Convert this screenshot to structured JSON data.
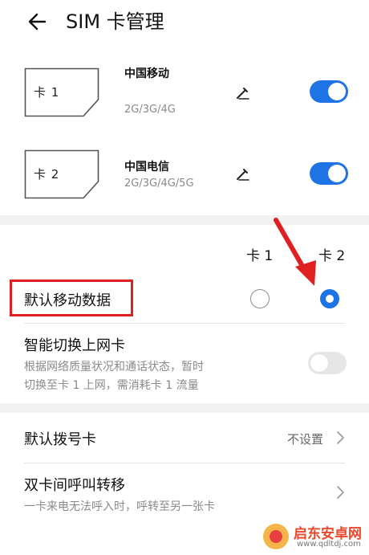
{
  "header": {
    "title": "SIM 卡管理",
    "back_icon": "arrow-left-icon"
  },
  "sim_cards": [
    {
      "slot_label": "卡 1",
      "carrier": "中国移动",
      "networks": "2G/3G/4G",
      "enabled": true
    },
    {
      "slot_label": "卡 2",
      "carrier": "中国电信",
      "networks": "2G/3G/4G/5G",
      "enabled": true
    }
  ],
  "default_data": {
    "col1_label": "卡 1",
    "col2_label": "卡 2",
    "title": "默认移动数据",
    "selected": "卡 2"
  },
  "smart_switch": {
    "title": "智能切换上网卡",
    "desc_line1": "根据网络质量状况和通话状态，暂时",
    "desc_line2": "切换至卡 1 上网，需消耗卡 1 流量",
    "enabled": false
  },
  "default_dial": {
    "title": "默认拨号卡",
    "value": "不设置"
  },
  "call_forward": {
    "title": "双卡间呼叫转移",
    "desc": "一卡来电无法呼入时，呼转至另一张卡"
  },
  "watermark": {
    "name": "启东安卓网",
    "url": "www.qdltdj.com"
  },
  "colors": {
    "accent": "#1e74e4",
    "annotation": "#e02020"
  }
}
